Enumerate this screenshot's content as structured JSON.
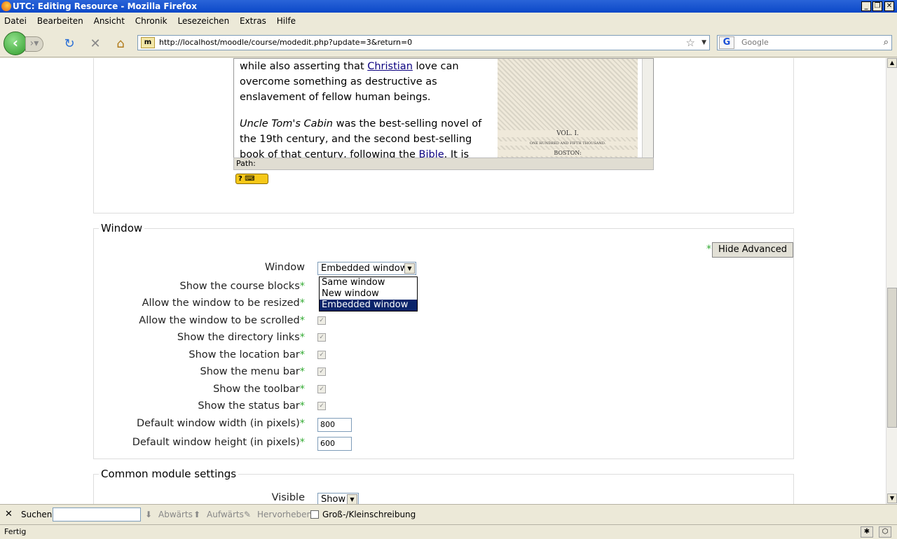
{
  "window": {
    "title": "UTC: Editing Resource - Mozilla Firefox",
    "min": "_",
    "max": "❐",
    "close": "✕"
  },
  "menu": [
    "Datei",
    "Bearbeiten",
    "Ansicht",
    "Chronik",
    "Lesezeichen",
    "Extras",
    "Hilfe"
  ],
  "nav": {
    "url": "http://localhost/moodle/course/modedit.php?update=3&return=0",
    "site_icon": "m",
    "search_placeholder": "Google",
    "search_engine": "G"
  },
  "editor": {
    "line1": "while also asserting that ",
    "link1": "Christian",
    "line1b": " love can overcome something as destructive as enslavement of fellow human beings.",
    "para2_italic": "Uncle Tom's Cabin",
    "para2": " was the best-selling novel of the 19th century, and the second best-selling book of that century, following the ",
    "link2": "Bible",
    "para2b": ". It is credited",
    "image_caption1": "VOL. I.",
    "image_caption2": "ONE HUNDRED AND FIFTH THOUSAND.",
    "image_caption3": "BOSTON:",
    "path_label": "Path:",
    "help_icon": "? ⌨"
  },
  "window_section": {
    "legend": "Window",
    "hide_advanced": "Hide Advanced",
    "required_mark": "*",
    "window_label": "Window",
    "window_value": "Embedded window",
    "window_options": [
      "Same window",
      "New window",
      "Embedded window"
    ],
    "course_blocks": "Show the course blocks",
    "resizable": "Allow the window to be resized",
    "scrollable": "Allow the window to be scrolled",
    "directory": "Show the directory links",
    "location": "Show the location bar",
    "menubar": "Show the menu bar",
    "toolbar": "Show the toolbar",
    "statusbar": "Show the status bar",
    "width_label": "Default window width (in pixels)",
    "width_value": "800",
    "height_label": "Default window height (in pixels)",
    "height_value": "600"
  },
  "common_section": {
    "legend": "Common module settings",
    "visible_label": "Visible",
    "visible_value": "Show"
  },
  "findbar": {
    "label": "Suchen:",
    "down": "Abwärts",
    "up": "Aufwärts",
    "highlight": "Hervorheben",
    "case": "Groß-/Kleinschreibung"
  },
  "status": {
    "text": "Fertig"
  }
}
